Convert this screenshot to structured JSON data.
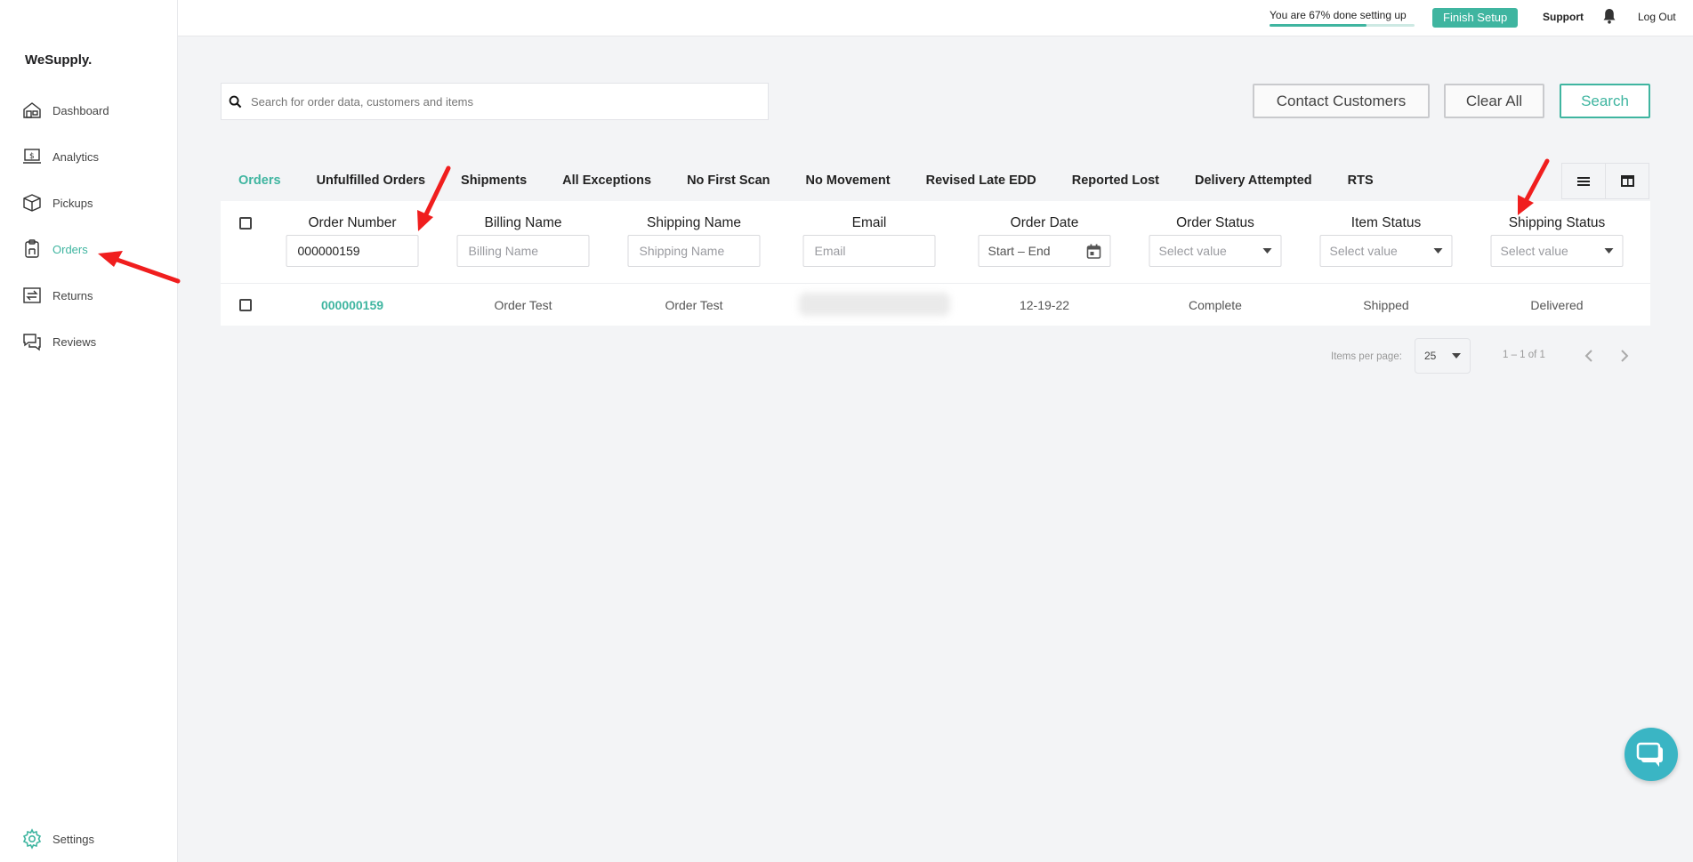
{
  "app": {
    "brand": "WeSupply."
  },
  "sidebar": {
    "items": [
      {
        "label": "Dashboard",
        "icon": "dashboard-icon"
      },
      {
        "label": "Analytics",
        "icon": "analytics-icon"
      },
      {
        "label": "Pickups",
        "icon": "box-icon"
      },
      {
        "label": "Orders",
        "icon": "orders-icon"
      },
      {
        "label": "Returns",
        "icon": "returns-icon"
      },
      {
        "label": "Reviews",
        "icon": "reviews-icon"
      }
    ],
    "settings": {
      "label": "Settings",
      "icon": "gear-icon"
    }
  },
  "topbar": {
    "progress_text": "You are 67% done setting up",
    "progress_fraction": 0.67,
    "finish_label": "Finish Setup",
    "support_label": "Support",
    "logout_label": "Log Out"
  },
  "search": {
    "placeholder": "Search for order data, customers and items"
  },
  "actions": {
    "contact": "Contact Customers",
    "clear": "Clear All",
    "search": "Search"
  },
  "tabs": [
    "Orders",
    "Unfulfilled Orders",
    "Shipments",
    "All Exceptions",
    "No First Scan",
    "No Movement",
    "Revised Late EDD",
    "Reported Lost",
    "Delivery Attempted",
    "RTS"
  ],
  "columns": {
    "order_number": {
      "label": "Order Number",
      "value": "000000159"
    },
    "billing_name": {
      "label": "Billing Name",
      "placeholder": "Billing Name"
    },
    "shipping_name": {
      "label": "Shipping Name",
      "placeholder": "Shipping Name"
    },
    "email": {
      "label": "Email",
      "placeholder": "Email"
    },
    "order_date": {
      "label": "Order Date",
      "placeholder": "Start – End"
    },
    "order_status": {
      "label": "Order Status",
      "placeholder": "Select value"
    },
    "item_status": {
      "label": "Item Status",
      "placeholder": "Select value"
    },
    "shipping_status": {
      "label": "Shipping Status",
      "placeholder": "Select value"
    }
  },
  "rows": [
    {
      "order_number": "000000159",
      "billing_name": "Order Test",
      "shipping_name": "Order Test",
      "email": "",
      "order_date": "12-19-22",
      "order_status": "Complete",
      "item_status": "Shipped",
      "shipping_status": "Delivered"
    }
  ],
  "pagination": {
    "items_per_page_label": "Items per page:",
    "items_per_page": "25",
    "range": "1 – 1 of 1"
  },
  "colors": {
    "accent": "#3fb5a0",
    "annotation": "#f01e1e",
    "chat": "#3ab5c4"
  }
}
